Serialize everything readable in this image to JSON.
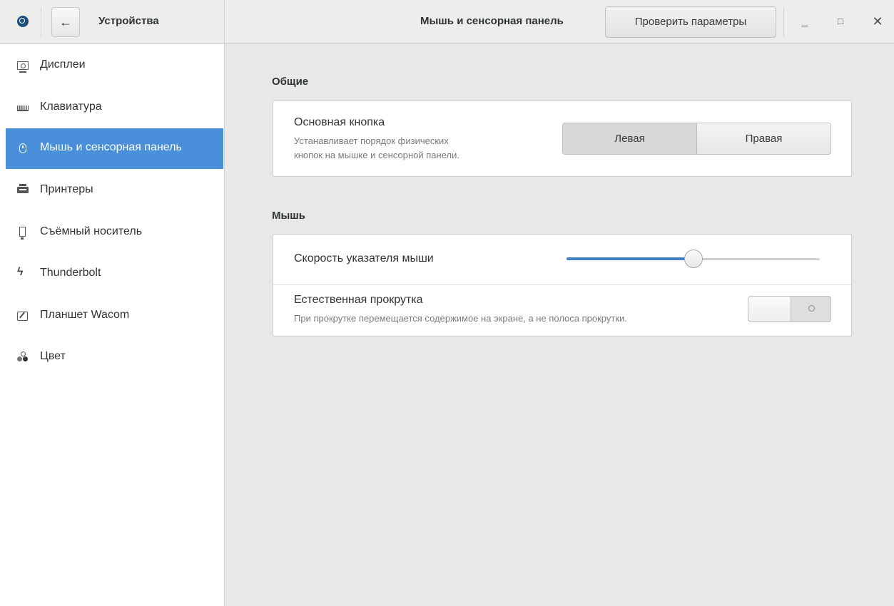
{
  "header": {
    "left_title": "Устройства",
    "back_symbol": "←",
    "title": "Мышь и сенсорная панель",
    "check_button_label": "Проверить параметры",
    "minimize_symbol": "_",
    "maximize_symbol": "□",
    "close_symbol": "✕"
  },
  "sidebar": {
    "items": [
      {
        "label": "Дисплеи",
        "icon": "display-icon"
      },
      {
        "label": "Клавиатура",
        "icon": "keyboard-icon"
      },
      {
        "label": "Мышь и сенсорная панель",
        "icon": "mouse-icon",
        "active": true
      },
      {
        "label": "Принтеры",
        "icon": "printer-icon"
      },
      {
        "label": "Съёмный носитель",
        "icon": "removable-media-icon"
      },
      {
        "label": "Thunderbolt",
        "icon": "thunderbolt-icon"
      },
      {
        "label": "Планшет Wacom",
        "icon": "tablet-icon"
      },
      {
        "label": "Цвет",
        "icon": "color-icon"
      }
    ]
  },
  "general": {
    "section_title": "Общие",
    "primary_button": {
      "title": "Основная кнопка",
      "description_line1": "Устанавливает порядок физических",
      "description_line2": "кнопок на мышке и сенсорной панели.",
      "options": [
        "Левая",
        "Правая"
      ],
      "selected": "Левая"
    }
  },
  "mouse": {
    "section_title": "Мышь",
    "pointer_speed": {
      "title": "Скорость указателя мыши",
      "value": 0.5
    },
    "natural_scrolling": {
      "title": "Естественная прокрутка",
      "description": "При прокрутке перемещается содержимое на экране, а не полоса прокрутки.",
      "enabled": false
    }
  },
  "colors": {
    "accent": "#4a8fd9",
    "slider_fill": "#3f7fc7"
  }
}
